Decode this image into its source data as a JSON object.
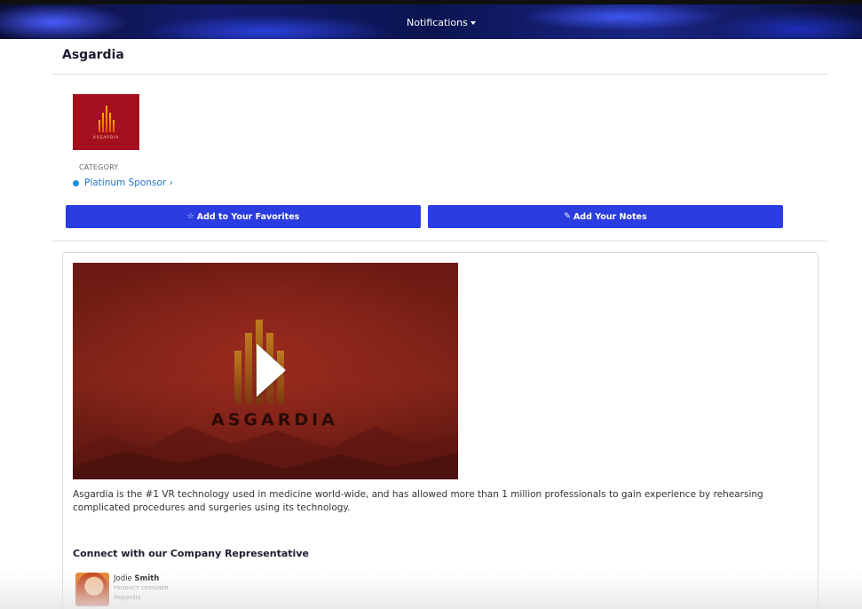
{
  "nav": {
    "notifications_label": "Notifications"
  },
  "page": {
    "title": "Asgardia"
  },
  "company": {
    "logo_text": "ASGARDIA",
    "category_label": "CATEGORY",
    "category_value": "Platinum Sponsor",
    "category_chevron": "›"
  },
  "actions": {
    "favorites_icon": "☆",
    "favorites_label": "Add to Your Favorites",
    "notes_icon": "✎",
    "notes_label": "Add Your Notes"
  },
  "video": {
    "brand_text": "ASGARDIA"
  },
  "description": "Asgardia is the #1 VR technology used in medicine world-wide, and has allowed more than 1 million professionals to gain experience by rehearsing complicated procedures and surgeries using its technology.",
  "representative": {
    "section_title": "Connect with our Company Representative",
    "first_name": "Jodie",
    "last_name": "Smith",
    "role": "PRODUCT DESIGNER",
    "company": "Asgardia"
  },
  "colors": {
    "primary_button": "#2b3de0",
    "link": "#2274c9",
    "logo_bg": "#a4101d"
  }
}
